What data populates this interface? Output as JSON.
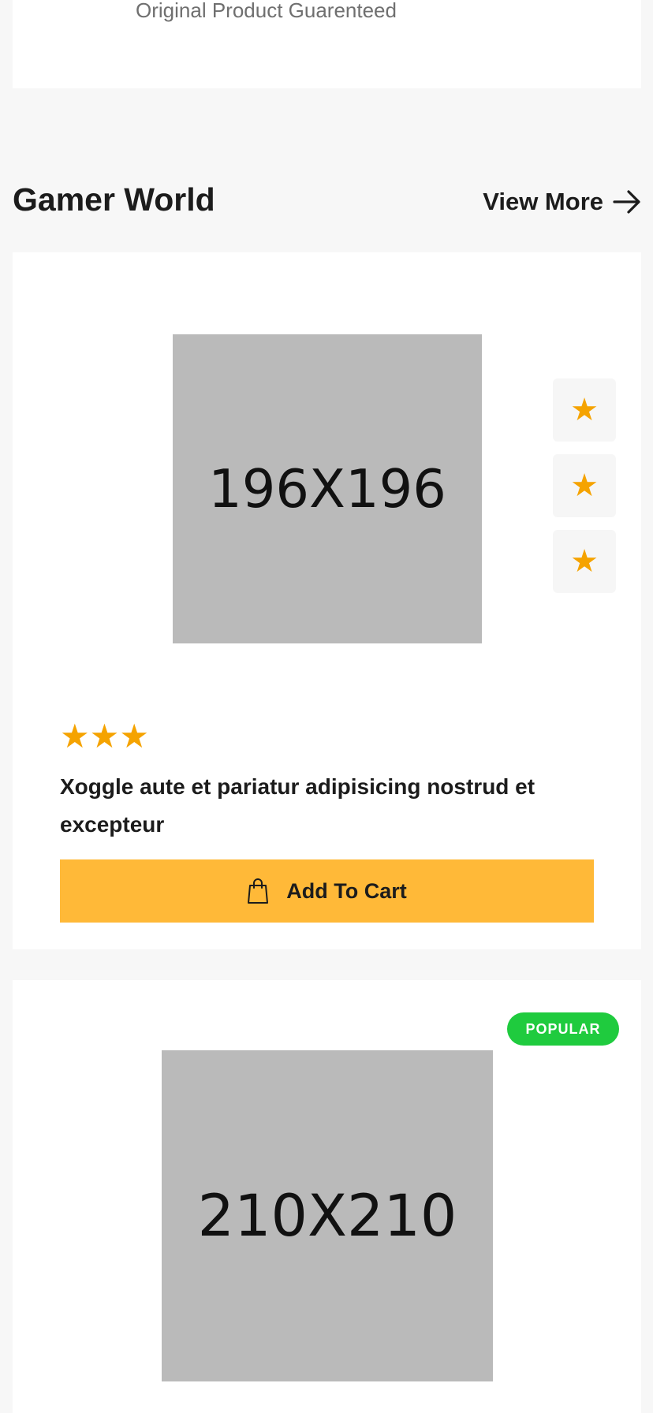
{
  "top_card": {
    "subtitle": "Original Product Guarenteed"
  },
  "section": {
    "title": "Gamer World",
    "view_more_label": "View More"
  },
  "product_1": {
    "image_placeholder": "196X196",
    "rating_stars": 3,
    "rating_icon": "★",
    "action_icon": "★",
    "action_icon_name": "star-icon",
    "title": "Xoggle aute et pariatur adipisicing nostrud et excepteur",
    "cart_label": "Add To Cart"
  },
  "product_2": {
    "badge": "POPULAR",
    "image_placeholder": "210X210"
  },
  "colors": {
    "accent_yellow": "#ffb938",
    "star": "#f5a300",
    "badge_green": "#1fcb3e",
    "placeholder_gray": "#bababa"
  }
}
